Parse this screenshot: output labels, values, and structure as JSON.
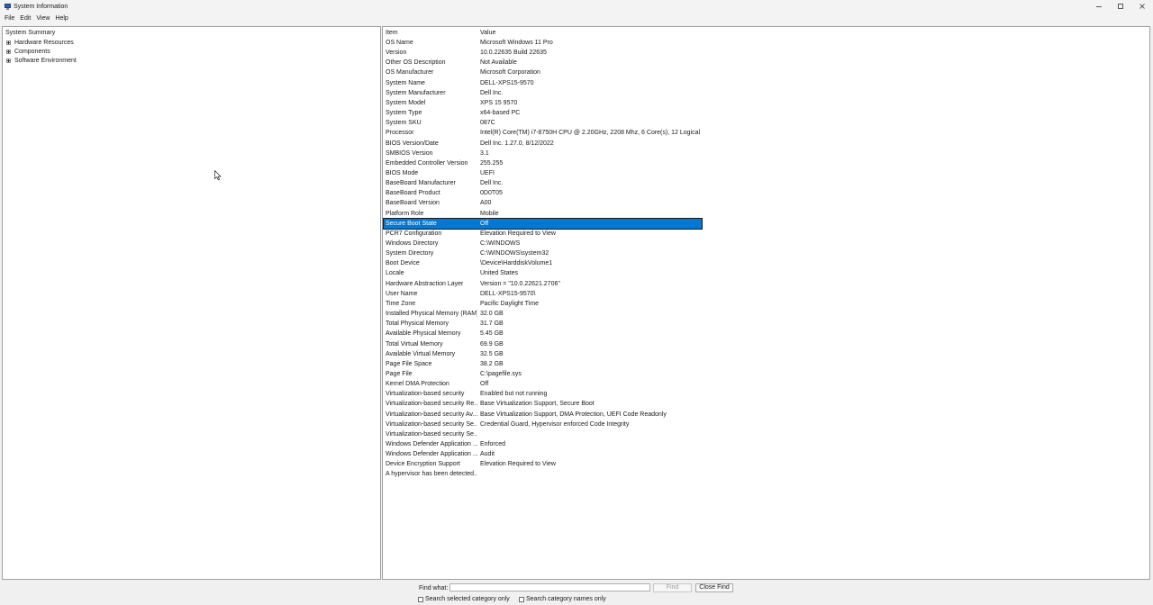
{
  "window": {
    "title": "System Information"
  },
  "menu": [
    "File",
    "Edit",
    "View",
    "Help"
  ],
  "tree": {
    "root": "System Summary",
    "children": [
      "Hardware Resources",
      "Components",
      "Software Environment"
    ]
  },
  "table": {
    "headers": [
      "Item",
      "Value"
    ],
    "selected_index": 19,
    "rows": [
      [
        "OS Name",
        "Microsoft Windows 11 Pro"
      ],
      [
        "Version",
        "10.0.22635 Build 22635"
      ],
      [
        "Other OS Description",
        "Not Available"
      ],
      [
        "OS Manufacturer",
        "Microsoft Corporation"
      ],
      [
        "System Name",
        "DELL-XPS15-9570"
      ],
      [
        "System Manufacturer",
        "Dell Inc."
      ],
      [
        "System Model",
        "XPS 15 9570"
      ],
      [
        "System Type",
        "x64-based PC"
      ],
      [
        "System SKU",
        "087C"
      ],
      [
        "Processor",
        "Intel(R) Core(TM) i7-8750H CPU @ 2.20GHz, 2208 Mhz, 6 Core(s), 12 Logical Pr..."
      ],
      [
        "BIOS Version/Date",
        "Dell Inc. 1.27.0, 8/12/2022"
      ],
      [
        "SMBIOS Version",
        "3.1"
      ],
      [
        "Embedded Controller Version",
        "255.255"
      ],
      [
        "BIOS Mode",
        "UEFI"
      ],
      [
        "BaseBoard Manufacturer",
        "Dell Inc."
      ],
      [
        "BaseBoard Product",
        "0D0T05"
      ],
      [
        "BaseBoard Version",
        "A00"
      ],
      [
        "Platform Role",
        "Mobile"
      ],
      [
        "Secure Boot State",
        "Off"
      ],
      [
        "PCR7 Configuration",
        "Elevation Required to View"
      ],
      [
        "Windows Directory",
        "C:\\WINDOWS"
      ],
      [
        "System Directory",
        "C:\\WINDOWS\\system32"
      ],
      [
        "Boot Device",
        "\\Device\\HarddiskVolume1"
      ],
      [
        "Locale",
        "United States"
      ],
      [
        "Hardware Abstraction Layer",
        "Version = \"10.0.22621.2706\""
      ],
      [
        "User Name",
        "DELL-XPS15-9570\\"
      ],
      [
        "Time Zone",
        "Pacific Daylight Time"
      ],
      [
        "Installed Physical Memory (RAM)",
        "32.0 GB"
      ],
      [
        "Total Physical Memory",
        "31.7 GB"
      ],
      [
        "Available Physical Memory",
        "5.45 GB"
      ],
      [
        "Total Virtual Memory",
        "69.9 GB"
      ],
      [
        "Available Virtual Memory",
        "32.5 GB"
      ],
      [
        "Page File Space",
        "38.2 GB"
      ],
      [
        "Page File",
        "C:\\pagefile.sys"
      ],
      [
        "Kernel DMA Protection",
        "Off"
      ],
      [
        "Virtualization-based security",
        "Enabled but not running"
      ],
      [
        "Virtualization-based security Re...",
        "Base Virtualization Support, Secure Boot"
      ],
      [
        "Virtualization-based security Av...",
        "Base Virtualization Support, DMA Protection, UEFI Code Readonly"
      ],
      [
        "Virtualization-based security Se...",
        "Credential Guard, Hypervisor enforced Code Integrity"
      ],
      [
        "Virtualization-based security Se...",
        ""
      ],
      [
        "Windows Defender Application ...",
        "Enforced"
      ],
      [
        "Windows Defender Application ...",
        "Audit"
      ],
      [
        "Device Encryption Support",
        "Elevation Required to View"
      ],
      [
        "A hypervisor has been detected...",
        ""
      ]
    ]
  },
  "find": {
    "label": "Find what:",
    "value": "",
    "find_button": "Find",
    "close_button": "Close Find",
    "search_selected": "Search selected category only",
    "search_names": "Search category names only"
  },
  "colors": {
    "selection": "#0078d7",
    "accent_icon": "#2f5fb8"
  }
}
